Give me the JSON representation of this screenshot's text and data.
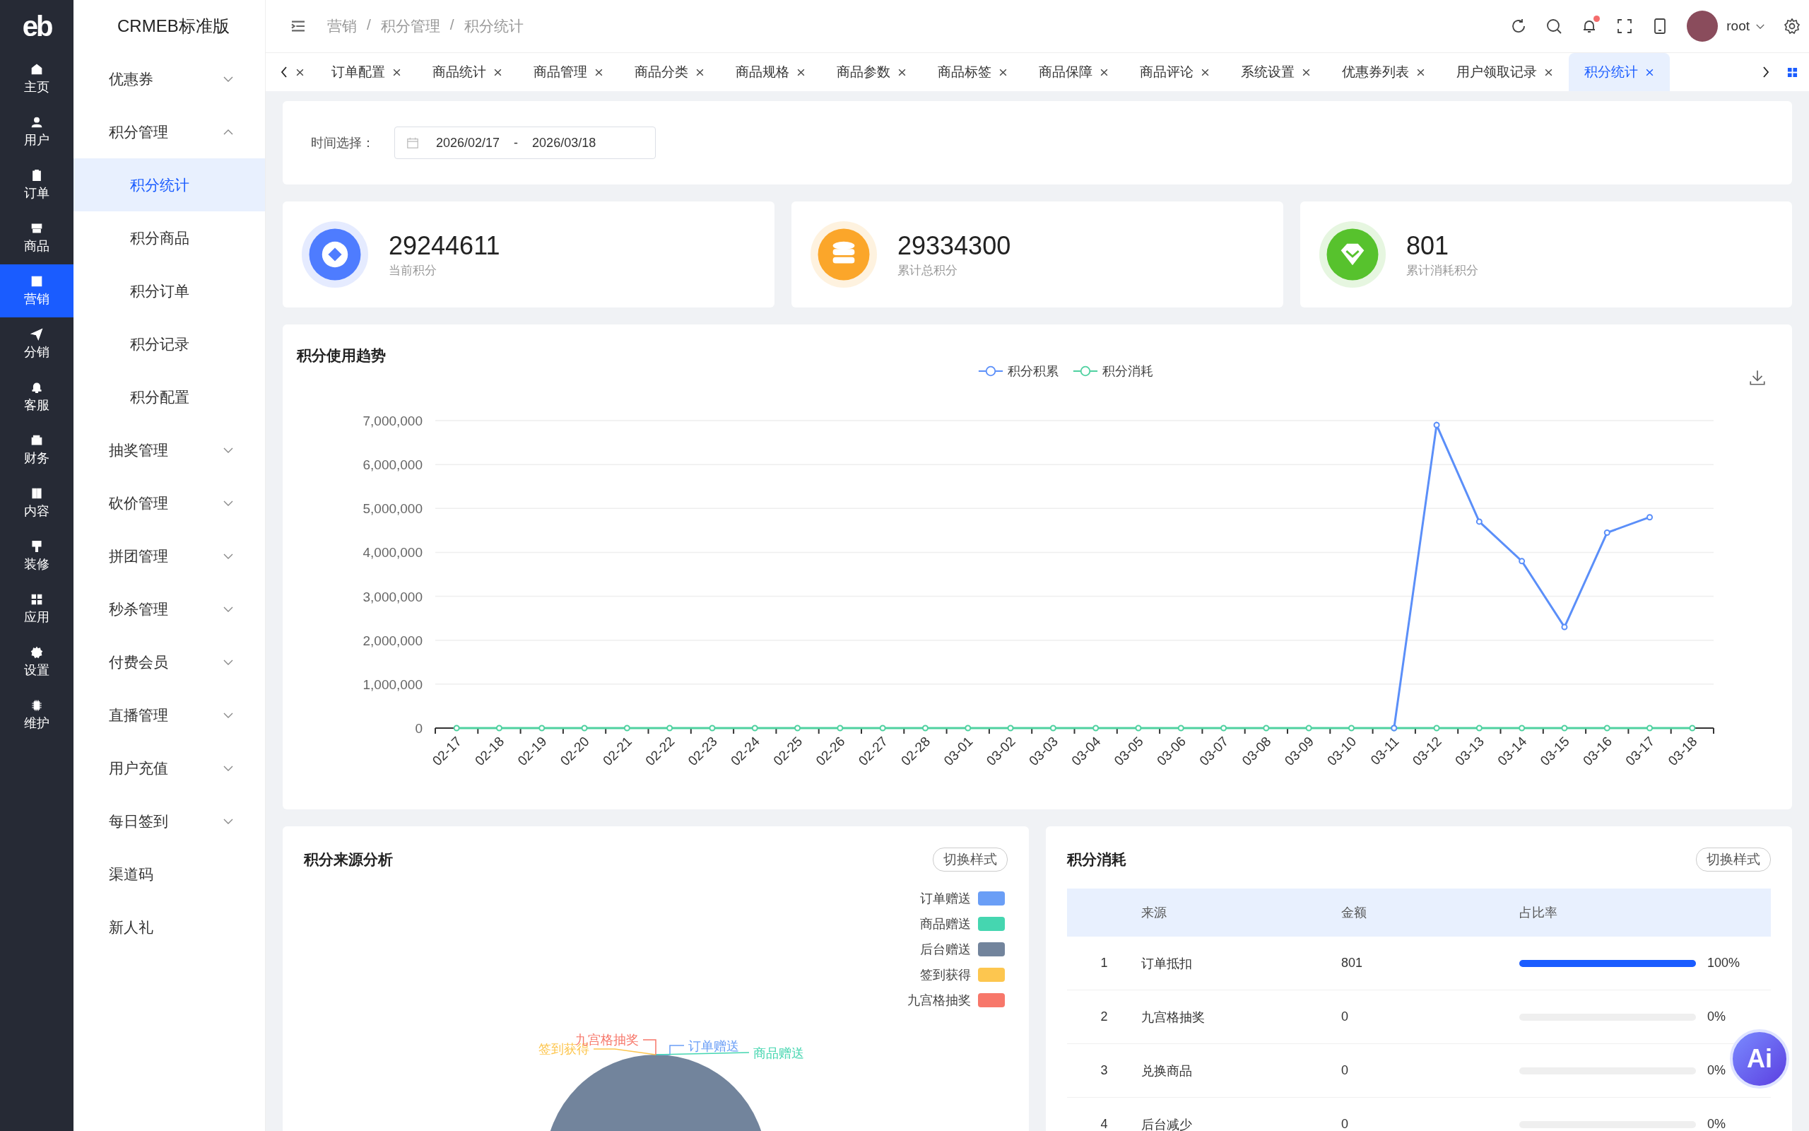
{
  "brand": {
    "logo": "eb",
    "title": "CRMEB标准版"
  },
  "rail": [
    {
      "label": "主页",
      "selected": false
    },
    {
      "label": "用户",
      "selected": false
    },
    {
      "label": "订单",
      "selected": false
    },
    {
      "label": "商品",
      "selected": false
    },
    {
      "label": "营销",
      "selected": true
    },
    {
      "label": "分销",
      "selected": false
    },
    {
      "label": "客服",
      "selected": false
    },
    {
      "label": "财务",
      "selected": false
    },
    {
      "label": "内容",
      "selected": false
    },
    {
      "label": "装修",
      "selected": false
    },
    {
      "label": "应用",
      "selected": false
    },
    {
      "label": "设置",
      "selected": false
    },
    {
      "label": "维护",
      "selected": false
    }
  ],
  "menu": [
    {
      "label": "优惠券",
      "kind": "group",
      "expanded": false
    },
    {
      "label": "积分管理",
      "kind": "group",
      "expanded": true,
      "children": [
        {
          "label": "积分统计",
          "selected": true
        },
        {
          "label": "积分商品",
          "selected": false
        },
        {
          "label": "积分订单",
          "selected": false
        },
        {
          "label": "积分记录",
          "selected": false
        },
        {
          "label": "积分配置",
          "selected": false
        }
      ]
    },
    {
      "label": "抽奖管理",
      "kind": "group",
      "expanded": false
    },
    {
      "label": "砍价管理",
      "kind": "group",
      "expanded": false
    },
    {
      "label": "拼团管理",
      "kind": "group",
      "expanded": false
    },
    {
      "label": "秒杀管理",
      "kind": "group",
      "expanded": false
    },
    {
      "label": "付费会员",
      "kind": "group",
      "expanded": false
    },
    {
      "label": "直播管理",
      "kind": "group",
      "expanded": false
    },
    {
      "label": "用户充值",
      "kind": "group",
      "expanded": false
    },
    {
      "label": "每日签到",
      "kind": "group",
      "expanded": false
    },
    {
      "label": "渠道码",
      "kind": "link"
    },
    {
      "label": "新人礼",
      "kind": "link"
    }
  ],
  "breadcrumb": {
    "items": [
      "营销",
      "积分管理",
      "积分统计"
    ],
    "separator": "/"
  },
  "header": {
    "user": "root",
    "notification": true
  },
  "tabs": [
    {
      "label": "订单配置",
      "selected": false
    },
    {
      "label": "商品统计",
      "selected": false
    },
    {
      "label": "商品管理",
      "selected": false
    },
    {
      "label": "商品分类",
      "selected": false
    },
    {
      "label": "商品规格",
      "selected": false
    },
    {
      "label": "商品参数",
      "selected": false
    },
    {
      "label": "商品标签",
      "selected": false
    },
    {
      "label": "商品保障",
      "selected": false
    },
    {
      "label": "商品评论",
      "selected": false
    },
    {
      "label": "系统设置",
      "selected": false
    },
    {
      "label": "优惠券列表",
      "selected": false
    },
    {
      "label": "用户领取记录",
      "selected": false
    },
    {
      "label": "积分统计",
      "selected": true
    }
  ],
  "filter": {
    "label": "时间选择：",
    "start": "2026/02/17",
    "separator": "-",
    "end": "2026/03/18"
  },
  "stats": [
    {
      "value": "29244611",
      "label": "当前积分",
      "color": "#4e7cff"
    },
    {
      "value": "29334300",
      "label": "累计总积分",
      "color": "#fba62a"
    },
    {
      "value": "801",
      "label": "累计消耗积分",
      "color": "#57c22d"
    }
  ],
  "trend": {
    "title": "积分使用趋势",
    "chart_data": {
      "type": "line",
      "categories": [
        "02-17",
        "02-18",
        "02-19",
        "02-20",
        "02-21",
        "02-22",
        "02-23",
        "02-24",
        "02-25",
        "02-26",
        "02-27",
        "02-28",
        "03-01",
        "03-02",
        "03-03",
        "03-04",
        "03-05",
        "03-06",
        "03-07",
        "03-08",
        "03-09",
        "03-10",
        "03-11",
        "03-12",
        "03-13",
        "03-14",
        "03-15",
        "03-16",
        "03-17",
        "03-18"
      ],
      "grid": true,
      "legend": true,
      "series": [
        {
          "name": "积分积累",
          "color": "#5b8ff9",
          "marker": "circle",
          "values": [
            null,
            null,
            null,
            null,
            null,
            null,
            null,
            null,
            null,
            null,
            null,
            null,
            null,
            null,
            null,
            null,
            null,
            null,
            null,
            null,
            null,
            null,
            0,
            6900000,
            4700000,
            3800000,
            2300000,
            4450000,
            4800000,
            null
          ]
        },
        {
          "name": "积分消耗",
          "color": "#4fd1a0",
          "marker": "circle",
          "values": [
            0,
            0,
            0,
            0,
            0,
            0,
            0,
            0,
            0,
            0,
            0,
            0,
            0,
            0,
            0,
            0,
            0,
            0,
            0,
            0,
            0,
            0,
            0,
            0,
            0,
            0,
            0,
            0,
            0,
            0
          ]
        }
      ],
      "ylim": [
        0,
        7000000
      ],
      "yticks": [
        {
          "value": 0,
          "label": "0"
        },
        {
          "value": 1000000,
          "label": "1,000,000"
        },
        {
          "value": 2000000,
          "label": "2,000,000"
        },
        {
          "value": 3000000,
          "label": "3,000,000"
        },
        {
          "value": 4000000,
          "label": "4,000,000"
        },
        {
          "value": 5000000,
          "label": "5,000,000"
        },
        {
          "value": 6000000,
          "label": "6,000,000"
        },
        {
          "value": 7000000,
          "label": "7,000,000"
        }
      ]
    }
  },
  "source": {
    "title": "积分来源分析",
    "switch": "切换样式",
    "legend": [
      {
        "label": "订单赠送",
        "color": "#6a9ef6",
        "dominant": false
      },
      {
        "label": "商品赠送",
        "color": "#45d6b0",
        "dominant": false
      },
      {
        "label": "后台赠送",
        "color": "#72849c",
        "dominant": true
      },
      {
        "label": "签到获得",
        "color": "#fdc64f",
        "dominant": false
      },
      {
        "label": "九宫格抽奖",
        "color": "#f7776a",
        "dominant": false
      }
    ],
    "callouts_left": [
      {
        "label": "签到获得",
        "color": "#fdc64f"
      },
      {
        "label": "九宫格抽奖",
        "color": "#f7776a"
      }
    ],
    "callouts_right": [
      {
        "label": "订单赠送",
        "color": "#6a9ef6"
      },
      {
        "label": "商品赠送",
        "color": "#45d6b0"
      }
    ]
  },
  "consumption": {
    "title": "积分消耗",
    "switch": "切换样式",
    "columns": [
      "来源",
      "金额",
      "占比率"
    ],
    "rows": [
      {
        "index": "1",
        "source": "订单抵扣",
        "amount": "801",
        "level": 1,
        "percent": "100%"
      },
      {
        "index": "2",
        "source": "九宫格抽奖",
        "amount": "0",
        "level": 0,
        "percent": "0%"
      },
      {
        "index": "3",
        "source": "兑换商品",
        "amount": "0",
        "level": 0,
        "percent": "0%"
      },
      {
        "index": "4",
        "source": "后台减少",
        "amount": "0",
        "level": 0,
        "percent": "0%"
      }
    ]
  },
  "ai_button": {
    "label": "Ai"
  }
}
